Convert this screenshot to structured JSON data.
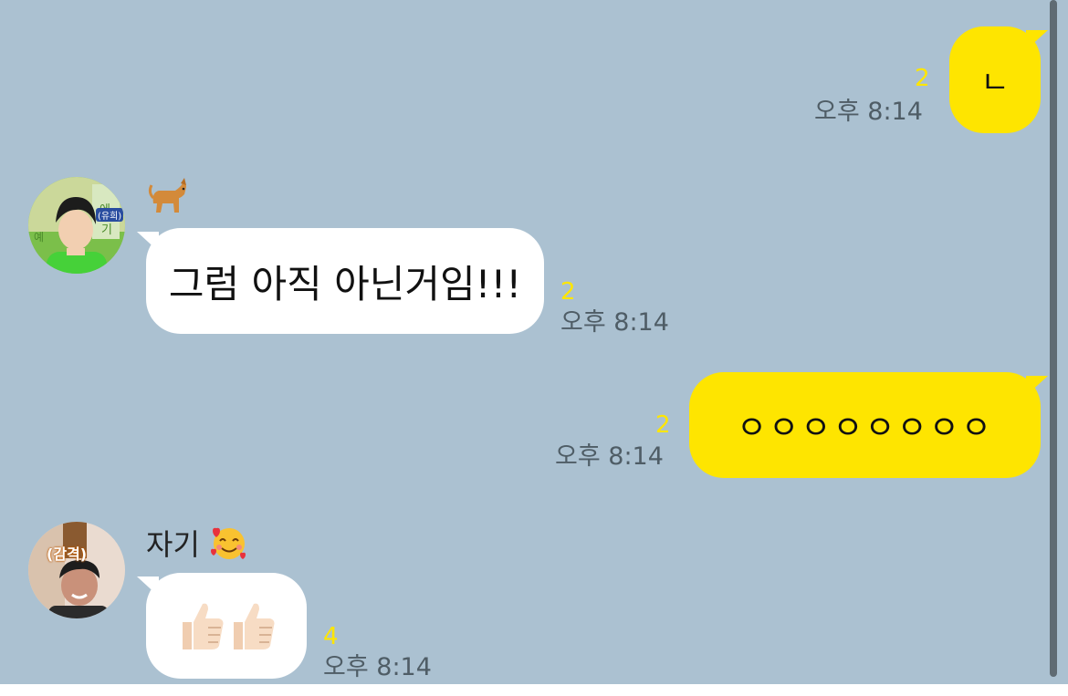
{
  "messages": [
    {
      "id": "m1",
      "side": "me",
      "text": "ㄴ",
      "unread": "2",
      "time": "오후 8:14"
    },
    {
      "id": "m2",
      "side": "them",
      "sender": "🐕",
      "text": "그럼 아직 아닌거임!!!",
      "unread": "2",
      "time": "오후 8:14",
      "avatar_badge": "(유희)"
    },
    {
      "id": "m3",
      "side": "me",
      "text": "ㅇㅇㅇㅇㅇㅇㅇㅇ",
      "unread": "2",
      "time": "오후 8:14"
    },
    {
      "id": "m4",
      "side": "them",
      "sender": "자기",
      "sender_emoji": "🥰",
      "text": "👍🏻👍🏻",
      "unread": "4",
      "time": "오후 8:14",
      "avatar_badge": "(감격)"
    }
  ],
  "colors": {
    "chat_background": "#abc1d1",
    "my_bubble": "#fee500",
    "their_bubble": "#ffffff",
    "unread_count": "#ffe600",
    "timestamp": "#4f5d66"
  }
}
